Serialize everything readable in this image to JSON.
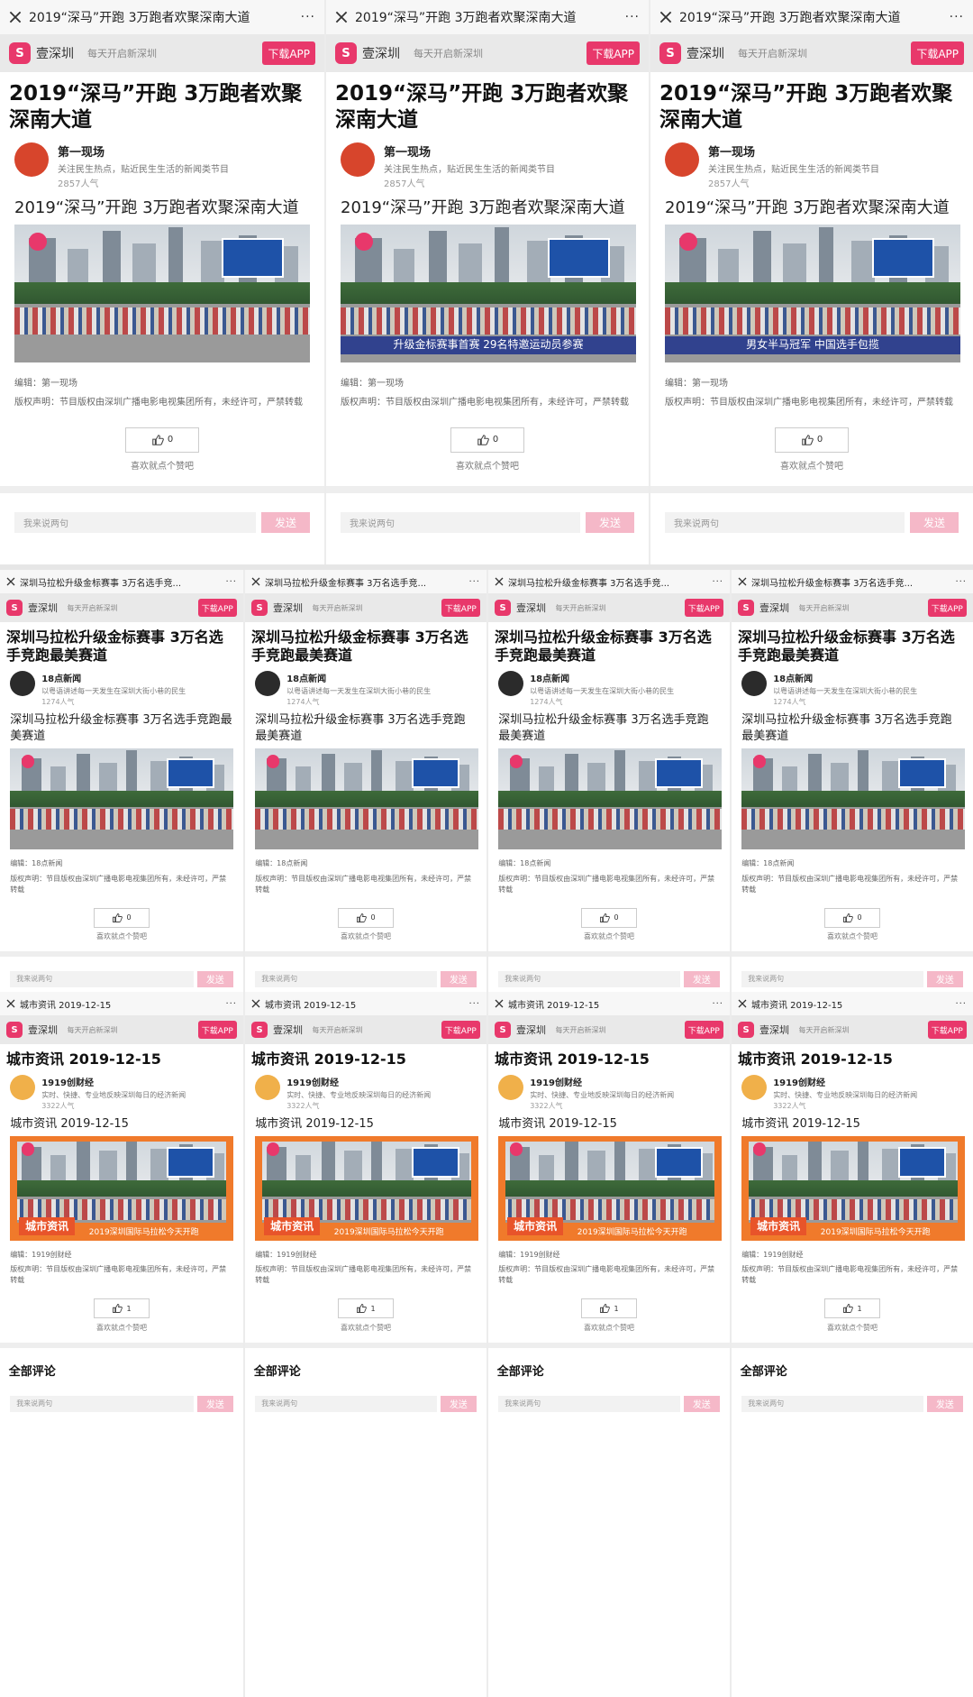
{
  "screens": [
    {
      "nav_title": "2019“深马”开跑 3万跑者欢聚深南大道",
      "nav_more": "···",
      "brand_name": "壹深圳",
      "brand_slogan": "每天开启新深圳",
      "download_label": "下载APP",
      "title": "2019“深马”开跑 3万跑者欢聚深南大道",
      "author_name": "第一现场",
      "author_desc": "关注民生热点，贴近民生生活的新闻类节目",
      "author_fans": "2857人气",
      "sub_title": "2019“深马”开跑 3万跑者欢聚深南大道",
      "editor": "编辑：第一现场",
      "copyright": "版权声明：节目版权由深圳广播电影电视集团所有，未经许可，严禁转载",
      "like_count": "0",
      "like_tip": "喜欢就点个赞吧",
      "comment_placeholder": "我来说两句",
      "send_label": "发送",
      "thumbs": [
        {
          "caption": ""
        },
        {
          "caption": "升级金标赛事首赛 29名特邀运动员参赛"
        },
        {
          "caption": "男女半马冠军 中国选手包揽"
        }
      ]
    },
    {
      "nav_title": "深圳马拉松升级金标赛事 3万名选手竞...",
      "nav_more": "···",
      "brand_name": "壹深圳",
      "brand_slogan": "每天开启新深圳",
      "download_label": "下载APP",
      "title": "深圳马拉松升级金标赛事 3万名选手竞跑最美赛道",
      "author_name": "18点新闻",
      "author_desc": "以粤语讲述每一天发生在深圳大街小巷的民生",
      "author_fans": "1274人气",
      "sub_title": "深圳马拉松升级金标赛事 3万名选手竞跑最美赛道",
      "editor": "编辑：18点新闻",
      "copyright": "版权声明：节目版权由深圳广播电影电视集团所有，未经许可，严禁转载",
      "like_count": "0",
      "like_tip": "喜欢就点个赞吧",
      "comment_placeholder": "我来说两句",
      "send_label": "发送",
      "thumbs": [
        {
          "caption": ""
        },
        {
          "caption": ""
        },
        {
          "caption": ""
        },
        {
          "caption": ""
        }
      ]
    },
    {
      "nav_title": "城市资讯 2019-12-15",
      "nav_more": "···",
      "brand_name": "壹深圳",
      "brand_slogan": "每天开启新深圳",
      "download_label": "下载APP",
      "title": "城市资讯 2019-12-15",
      "author_name": "1919创财经",
      "author_desc": "实时、快捷、专业地反映深圳每日的经济新闻",
      "author_fans": "3322人气",
      "sub_title": "城市资讯 2019-12-15",
      "frame_label": "城市资讯",
      "frame_caption": "2019深圳国际马拉松今天开跑",
      "editor": "编辑：1919创财经",
      "copyright": "版权声明：节目版权由深圳广播电影电视集团所有，未经许可，严禁转载",
      "like_count": "1",
      "like_tip": "喜欢就点个赞吧",
      "all_comments": "全部评论",
      "comment_placeholder": "我来说两句",
      "send_label": "发送",
      "thumbs": [
        {},
        {},
        {},
        {}
      ]
    }
  ]
}
